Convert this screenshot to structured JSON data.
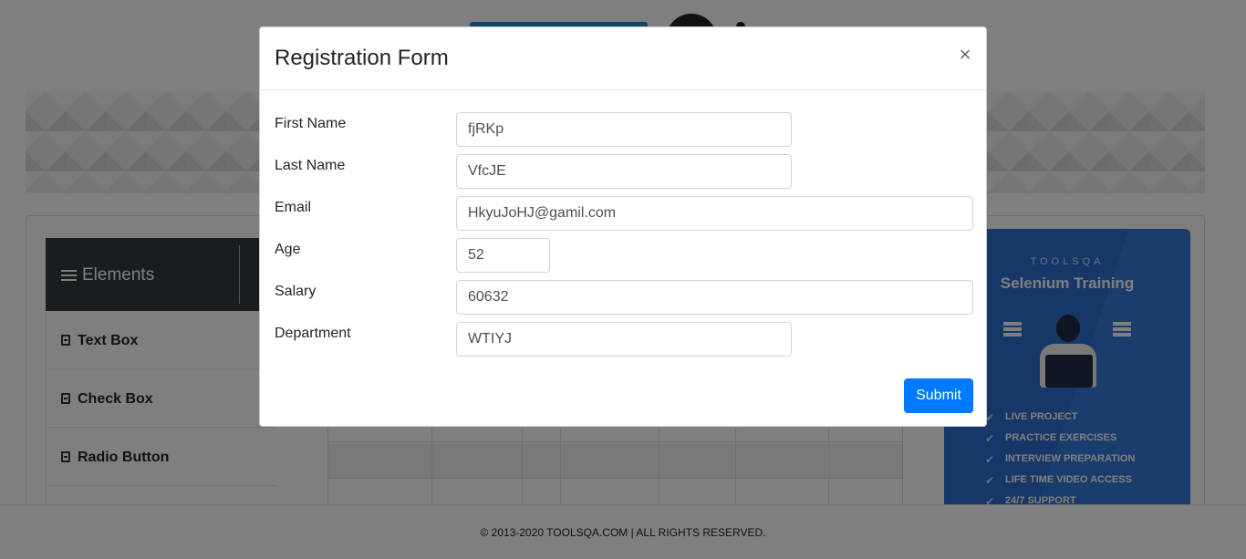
{
  "modal": {
    "title": "Registration Form",
    "close_glyph": "×",
    "fields": [
      {
        "label": "First Name",
        "value": "fjRKp"
      },
      {
        "label": "Last Name",
        "value": "VfcJE"
      },
      {
        "label": "Email",
        "value": "HkyuJoHJ@gamil.com"
      },
      {
        "label": "Age",
        "value": "52"
      },
      {
        "label": "Salary",
        "value": "60632"
      },
      {
        "label": "Department",
        "value": "WTIYJ"
      }
    ],
    "submit_label": "Submit"
  },
  "sidebar": {
    "header_label": "Elements",
    "items": [
      {
        "label": "Text Box"
      },
      {
        "label": "Check Box"
      },
      {
        "label": "Radio Button"
      }
    ]
  },
  "ad": {
    "brand": "TOOLSQA",
    "title": "Selenium Training",
    "bullets": [
      "LIVE PROJECT",
      "PRACTICE EXERCISES",
      "INTERVIEW PREPARATION",
      "LIFE TIME VIDEO ACCESS",
      "24/7 SUPPORT"
    ]
  },
  "footer": {
    "text": "© 2013-2020 TOOLSQA.COM | ALL RIGHTS RESERVED."
  },
  "colors": {
    "primary_button": "#007bff",
    "sidebar_header": "#343a40",
    "ad_background": "#2f6fd1",
    "overlay": "rgba(0,0,0,0.5)"
  }
}
